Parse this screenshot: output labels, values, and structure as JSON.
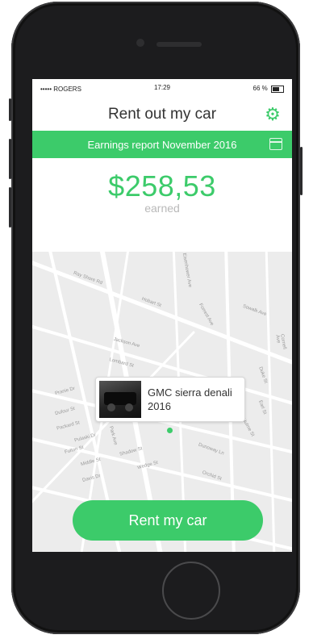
{
  "status_bar": {
    "carrier": "••••• ROGERS",
    "time": "17:29",
    "battery": "66 %"
  },
  "header": {
    "title": "Rent out my car",
    "settings_icon": "gear-icon"
  },
  "banner": {
    "text": "Earnings report November 2016",
    "calendar_icon": "calendar-icon"
  },
  "earnings": {
    "amount": "$258,53",
    "label": "earned"
  },
  "map": {
    "streets": [
      "Ray Shore Rd",
      "Eisenhower Ave",
      "Hobart St",
      "Forrest Ave",
      "Sowalk Ave",
      "Jackson Ave",
      "Lombard St",
      "Pranie Dr",
      "Dufour St",
      "Packard St",
      "Pulaski Dr",
      "Park Ave",
      "Fulton St",
      "Middle St",
      "Shadow St",
      "Wedge St",
      "Davis Dr",
      "Orchid St",
      "Dunoway Ln",
      "Hulme St",
      "Earl St",
      "Duke St",
      "Cornell Ave"
    ],
    "callout": {
      "title": "GMC sierra denali 2016"
    }
  },
  "actions": {
    "rent_button": "Rent my car"
  },
  "colors": {
    "accent": "#3ccb6a",
    "map_background": "#ececec"
  }
}
